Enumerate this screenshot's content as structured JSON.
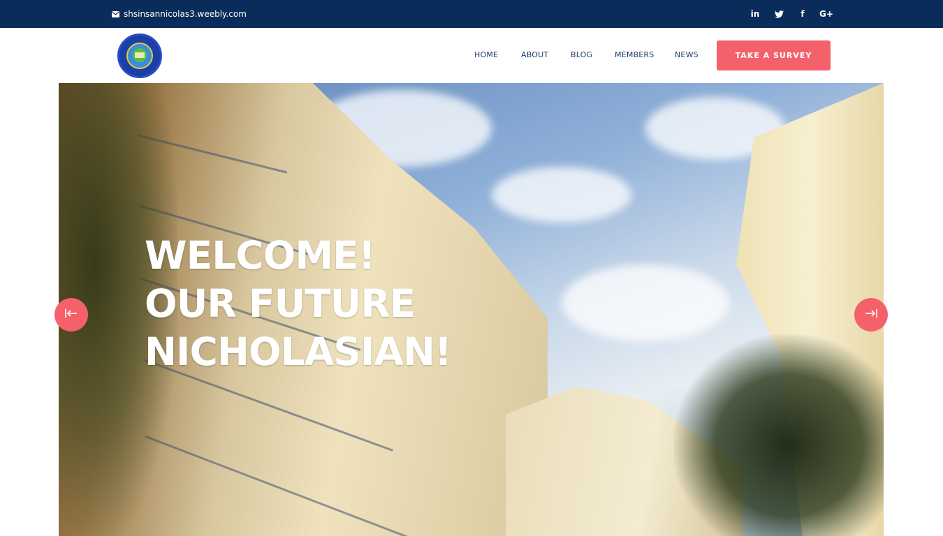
{
  "topbar": {
    "email": "shsinsannicolas3.weebly.com",
    "email_icon": "envelope-icon",
    "social": [
      {
        "name": "linkedin-icon",
        "glyph": "in"
      },
      {
        "name": "twitter-icon",
        "glyph": "t"
      },
      {
        "name": "facebook-icon",
        "glyph": "f"
      },
      {
        "name": "google-plus-icon",
        "glyph": "G+"
      }
    ]
  },
  "header": {
    "logo_icon": "school-seal-logo",
    "nav": {
      "home": "HOME",
      "about": "ABOUT",
      "blog": "BLOG",
      "members": "MEMBERS",
      "news": "NEWS"
    },
    "survey_button": "TAKE A SURVEY"
  },
  "hero": {
    "title_line1": "WELCOME!",
    "title_line2": "OUR FUTURE",
    "title_line3": "NICHOLASIAN!",
    "prev_icon": "arrow-left-to-bar-icon",
    "next_icon": "arrow-right-to-bar-icon"
  },
  "colors": {
    "topbar_bg": "#0a2c5a",
    "accent": "#f5616a",
    "nav_text": "#1c3d6b"
  }
}
